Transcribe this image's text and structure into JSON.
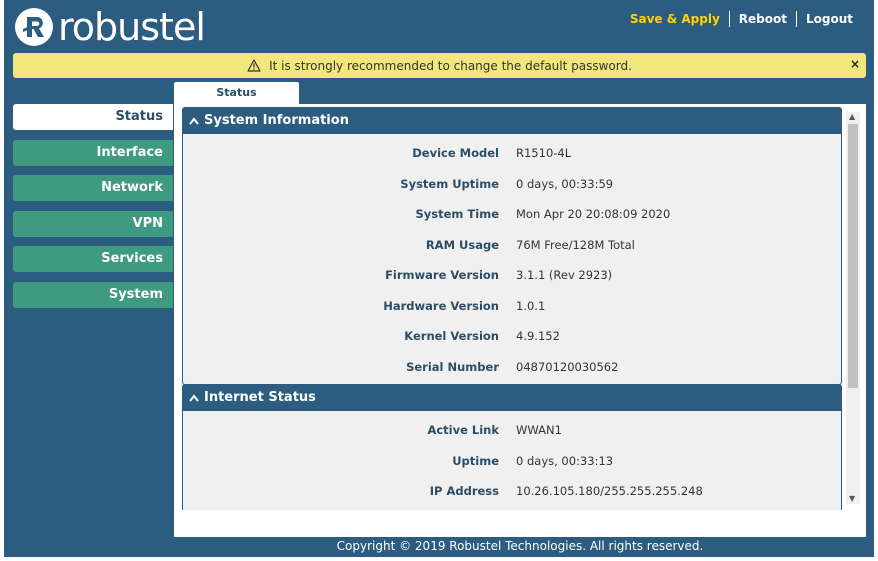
{
  "header": {
    "brand": "robustel",
    "actions": {
      "save_apply": "Save & Apply",
      "reboot": "Reboot",
      "logout": "Logout"
    }
  },
  "warning": {
    "icon": "warning-icon",
    "text": "It is strongly recommended to change the default password.",
    "close": "×"
  },
  "sidebar": {
    "items": [
      {
        "label": "Status"
      },
      {
        "label": "Interface"
      },
      {
        "label": "Network"
      },
      {
        "label": "VPN"
      },
      {
        "label": "Services"
      },
      {
        "label": "System"
      }
    ]
  },
  "tab": {
    "label": "Status"
  },
  "system_information": {
    "title": "System Information",
    "rows": [
      {
        "label": "Device Model",
        "value": "R1510-4L"
      },
      {
        "label": "System Uptime",
        "value": "0 days, 00:33:59"
      },
      {
        "label": "System Time",
        "value": "Mon Apr 20 20:08:09 2020"
      },
      {
        "label": "RAM Usage",
        "value": "76M Free/128M Total"
      },
      {
        "label": "Firmware Version",
        "value": "3.1.1 (Rev 2923)"
      },
      {
        "label": "Hardware Version",
        "value": "1.0.1"
      },
      {
        "label": "Kernel Version",
        "value": "4.9.152"
      },
      {
        "label": "Serial Number",
        "value": "04870120030562"
      }
    ]
  },
  "internet_status": {
    "title": "Internet Status",
    "rows": [
      {
        "label": "Active Link",
        "value": "WWAN1"
      },
      {
        "label": "Uptime",
        "value": "0 days, 00:33:13"
      },
      {
        "label": "IP Address",
        "value": "10.26.105.180/255.255.255.248"
      }
    ]
  },
  "footer": {
    "copyright": "Copyright © 2019 Robustel Technologies. All rights reserved."
  },
  "colors": {
    "frame": "#2c5c80",
    "sidebar_item": "#3e9a80",
    "save_apply": "#ffd200",
    "warning_bg": "#f3e77b"
  }
}
